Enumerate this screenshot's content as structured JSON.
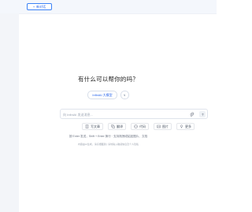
{
  "header": {
    "new_chat_label": "新对话"
  },
  "main": {
    "greeting": "有什么可以帮你的吗？",
    "model": {
      "name": "InfiniAI 大模型",
      "caret": "∨"
    },
    "input": {
      "placeholder": "向 InfiniAI 发送消息..."
    },
    "tools": [
      {
        "label": "写文章",
        "icon": "document-icon"
      },
      {
        "label": "翻译",
        "icon": "translate-icon"
      },
      {
        "label": "代码",
        "icon": "code-icon"
      },
      {
        "label": "图片",
        "icon": "image-icon"
      },
      {
        "label": "更多",
        "icon": "lightbulb-icon"
      }
    ],
    "hint": "按 Enter 发送，Shift + Enter 换行 · 支持拖拽或粘贴图片、文档",
    "footer": "内容由AI生成，请仔细甄别 | 请勿输入敏感信息及个人隐私"
  }
}
